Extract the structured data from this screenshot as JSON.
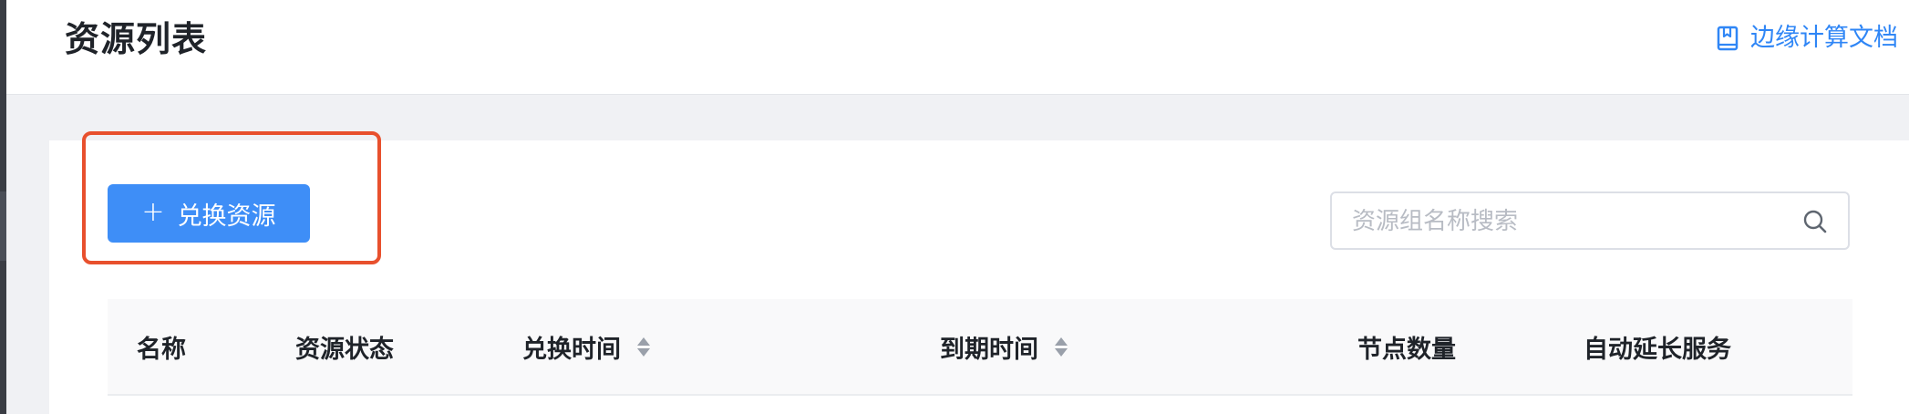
{
  "header": {
    "title": "资源列表",
    "docs_link": {
      "label": "边缘计算文档",
      "icon": "book-icon"
    }
  },
  "toolbar": {
    "redeem_button": {
      "label": "兑换资源",
      "icon": "plus-icon"
    },
    "search": {
      "placeholder": "资源组名称搜索",
      "value": "",
      "icon": "search-icon"
    }
  },
  "table": {
    "columns": [
      {
        "label": "名称",
        "sortable": false
      },
      {
        "label": "资源状态",
        "sortable": false
      },
      {
        "label": "兑换时间",
        "sortable": true
      },
      {
        "label": "到期时间",
        "sortable": true
      },
      {
        "label": "节点数量",
        "sortable": false
      },
      {
        "label": "自动延长服务",
        "sortable": false
      }
    ]
  },
  "colors": {
    "accent": "#3e8ef7",
    "link": "#2f86f6",
    "highlight": "#e8502d",
    "page_bg": "#f0f1f4"
  }
}
